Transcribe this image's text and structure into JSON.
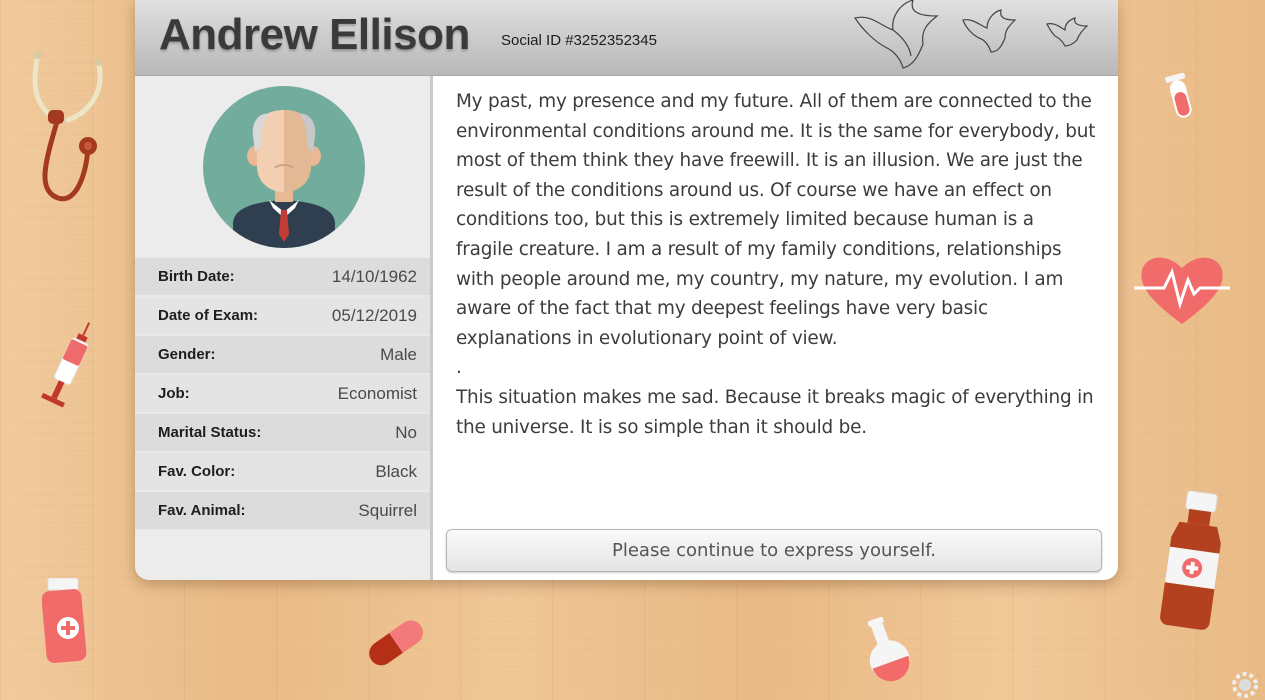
{
  "profile": {
    "name": "Andrew Ellison",
    "social_id": "Social ID #3252352345"
  },
  "info": [
    {
      "label": "Birth Date:",
      "value": "14/10/1962"
    },
    {
      "label": "Date of Exam:",
      "value": "05/12/2019"
    },
    {
      "label": "Gender:",
      "value": "Male"
    },
    {
      "label": "Job:",
      "value": "Economist"
    },
    {
      "label": "Marital Status:",
      "value": "No"
    },
    {
      "label": "Fav. Color:",
      "value": "Black"
    },
    {
      "label": "Fav. Animal:",
      "value": "Squirrel"
    }
  ],
  "statement": {
    "paragraph1": "My past, my presence and my future. All of them are connected to the environmental conditions around me. It is the same for everybody, but most of them think they have freewill. It is an illusion. We are just the result of the conditions around us. Of course we have an effect on conditions too, but this is extremely limited because human is a fragile creature. I am a result of my family conditions, relationships with people around me, my country, my nature, my evolution. I am aware of the fact that my deepest feelings have very basic explanations in evolutionary point of view.",
    "separator": ".",
    "paragraph2": "This situation makes me sad. Because it breaks magic of everything in the universe. It is so simple than it should be."
  },
  "continue_button": {
    "label": "Please continue to express yourself."
  },
  "colors": {
    "header_gradient": [
      "#e0e0e0",
      "#b8b8b8"
    ],
    "avatar_bg": "#72ac9c",
    "accent_red": "#f06a6a",
    "wood": "#ecbf8c"
  },
  "icons": [
    "dove-icon",
    "stethoscope-icon",
    "syringe-icon",
    "pill-bottle-icon",
    "capsule-icon",
    "flask-icon",
    "test-tube-icon",
    "heart-pulse-icon",
    "medicine-bottle-icon",
    "settings-gear-icon"
  ]
}
